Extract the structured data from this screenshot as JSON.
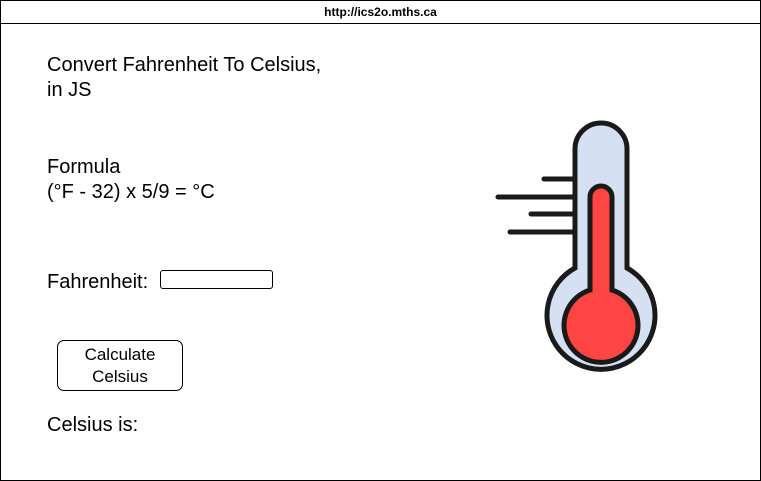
{
  "browser": {
    "url": "http://ics2o.mths.ca"
  },
  "header": {
    "title_line1": "Convert Fahrenheit To Celsius,",
    "title_line2": "in JS"
  },
  "formula": {
    "label": "Formula",
    "expression": "(°F - 32) x 5/9 = °C"
  },
  "form": {
    "fahrenheit_label": "Fahrenheit:",
    "fahrenheit_value": "",
    "calculate_line1": "Calculate",
    "calculate_line2": "Celsius"
  },
  "output": {
    "celsius_label": "Celsius is:"
  },
  "illustration": {
    "icon": "thermometer-icon",
    "colors": {
      "glass": "#d5e1f3",
      "mercury": "#ff4444",
      "outline": "#1a1a1a"
    }
  }
}
